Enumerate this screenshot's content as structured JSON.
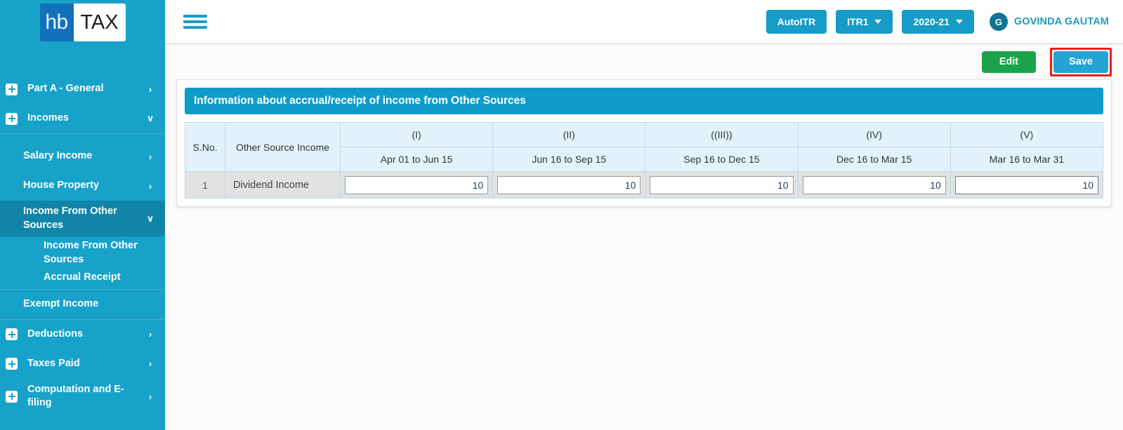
{
  "brand": {
    "logo_left": "hb",
    "logo_right": "TAX",
    "accent_blue": "#17a2c9",
    "header_blue": "#109cc8",
    "edit_green": "#1aa34a",
    "save_blue": "#25a4d4",
    "highlight_red": "#ef1c1c"
  },
  "sidebar": {
    "items": [
      {
        "label": "Part A - General",
        "icon": "plus-box-icon",
        "chevron": "›",
        "level": 0,
        "active": false
      },
      {
        "label": "Incomes",
        "icon": "plus-box-icon",
        "chevron": "∨",
        "level": 0,
        "active": false
      },
      {
        "label": "Salary Income",
        "icon": "",
        "chevron": "›",
        "level": 1,
        "active": false
      },
      {
        "label": "House Property",
        "icon": "",
        "chevron": "›",
        "level": 1,
        "active": false
      },
      {
        "label": "Income From Other Sources",
        "icon": "",
        "chevron": "∨",
        "level": 1,
        "active": true
      },
      {
        "label": "Income From Other Sources",
        "icon": "",
        "chevron": "",
        "level": 2,
        "active": false
      },
      {
        "label": "Accrual Receipt",
        "icon": "",
        "chevron": "",
        "level": 2,
        "active": false
      },
      {
        "label": "Exempt Income",
        "icon": "",
        "chevron": "",
        "level": 1,
        "active": false
      },
      {
        "label": "Deductions",
        "icon": "plus-box-icon",
        "chevron": "›",
        "level": 0,
        "active": false
      },
      {
        "label": "Taxes Paid",
        "icon": "plus-box-icon",
        "chevron": "›",
        "level": 0,
        "active": false
      },
      {
        "label": "Computation and E-filing",
        "icon": "plus-box-icon",
        "chevron": "›",
        "level": 0,
        "active": false
      }
    ]
  },
  "topbar": {
    "menu_icon": "hamburger-icon",
    "auto_itr_label": "AutoITR",
    "itr_select_label": "ITR1",
    "year_select_label": "2020-21",
    "avatar_initial": "G",
    "user_name": "GOVINDA GAUTAM"
  },
  "actions": {
    "edit_label": "Edit",
    "save_label": "Save"
  },
  "card": {
    "title": "Information about accrual/receipt of income from Other Sources",
    "columns": {
      "sno": "S.No.",
      "source": "Other Source Income",
      "periods": [
        {
          "roman": "(I)",
          "range": "Apr 01 to Jun 15"
        },
        {
          "roman": "(II)",
          "range": "Jun 16 to Sep 15"
        },
        {
          "roman": "((III))",
          "range": "Sep 16 to Dec 15"
        },
        {
          "roman": "(IV)",
          "range": "Dec 16 to Mar 15"
        },
        {
          "roman": "(V)",
          "range": "Mar 16 to Mar 31"
        }
      ]
    },
    "rows": [
      {
        "sno": "1",
        "source": "Dividend Income",
        "values": [
          "10",
          "10",
          "10",
          "10",
          "10"
        ],
        "focused_index": 4
      }
    ]
  }
}
